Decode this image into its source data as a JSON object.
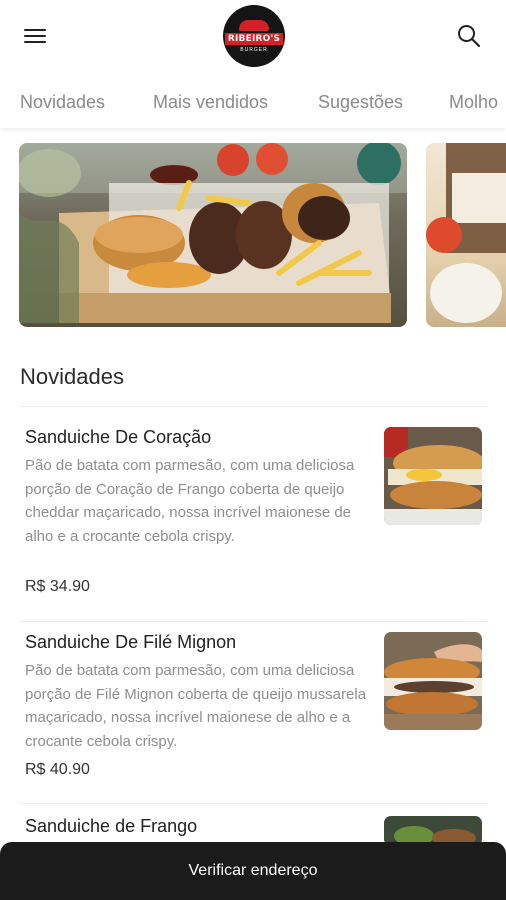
{
  "header": {
    "menu_icon": "hamburger-menu-icon",
    "logo": {
      "brand": "RIBEIRO'S",
      "sub": "BURGER"
    },
    "search_icon": "search-icon"
  },
  "tabs": [
    {
      "label": "Novidades"
    },
    {
      "label": "Mais vendidos"
    },
    {
      "label": "Sugestões"
    },
    {
      "label": "Molho"
    }
  ],
  "section": {
    "title": "Novidades"
  },
  "items": [
    {
      "name": "Sanduiche De Coração",
      "description": "Pão de batata com parmesão, com uma deliciosa porção de Coração de Frango coberta de queijo cheddar maçaricado, nossa incrível maionese de alho e a crocante cebola crispy.",
      "price": "R$ 34.90"
    },
    {
      "name": "Sanduiche De Filé Mignon",
      "description": "Pão de batata com parmesão, com uma deliciosa porção de Filé Mignon coberta de queijo mussarela maçaricado, nossa incrível maionese de alho e a crocante cebola crispy.",
      "price": "R$ 40.90"
    },
    {
      "name": "Sanduiche de Frango"
    }
  ],
  "bottom_bar": {
    "label": "Verificar endereço"
  },
  "colors": {
    "brand_red": "#d32127",
    "bottom_bar": "#1b1b1b",
    "muted_text": "#8e8e8e"
  }
}
